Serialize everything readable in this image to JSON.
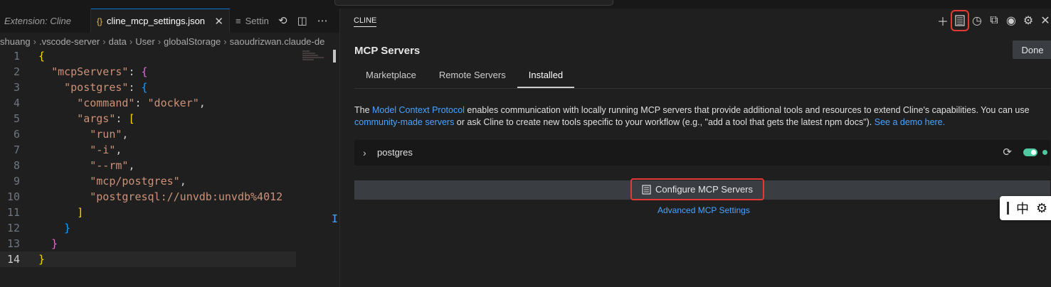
{
  "editor": {
    "tabs": [
      {
        "label": "Extension: Cline"
      },
      {
        "label": "cline_mcp_settings.json",
        "icon": "{}"
      },
      {
        "label": "Settin"
      }
    ],
    "tab_close": "✕",
    "breadcrumb": [
      "shuang",
      ".vscode-server",
      "data",
      "User",
      "globalStorage",
      "saoudrizwan.claude-de"
    ],
    "line_numbers": [
      "1",
      "2",
      "3",
      "4",
      "5",
      "6",
      "7",
      "8",
      "9",
      "10",
      "11",
      "12",
      "13",
      "14"
    ]
  },
  "panel": {
    "title": "CLINE",
    "heading": "MCP Servers",
    "done_label": "Done",
    "tabs": [
      "Marketplace",
      "Remote Servers",
      "Installed"
    ],
    "description": {
      "part1": "The ",
      "link1": "Model Context Protocol",
      "part2": " enables communication with locally running MCP servers that provide additional tools and resources to extend Cline's capabilities. You can use ",
      "link2": "community-made servers",
      "part3": " or ask Cline to create new tools specific to your workflow (e.g., \"add a tool that gets the latest npm docs\"). ",
      "link3": "See a demo here."
    },
    "server": {
      "name": "postgres"
    },
    "configure_label": "Configure MCP Servers",
    "advanced_label": "Advanced MCP Settings"
  },
  "ime": {
    "label": "中"
  }
}
